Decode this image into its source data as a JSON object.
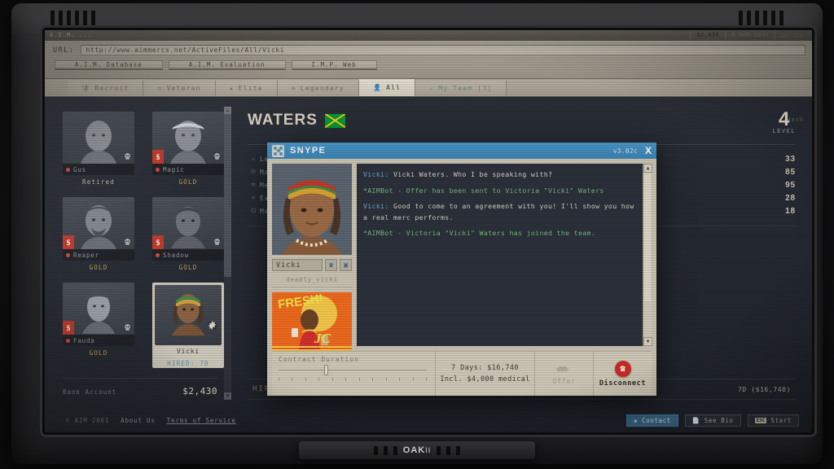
{
  "device": {
    "brand": "OAK",
    "brand_suffix": "II"
  },
  "browser": {
    "window_title": "A.I.M. ...",
    "url_label": "URL:",
    "url_value": "http://www.aimmercs.net/ActiveFiles/All/Vicki",
    "tabs": [
      {
        "label": "A.I.M. Database"
      },
      {
        "label": "A.I.M. Evaluation"
      },
      {
        "label": "I.M.P. Web"
      }
    ],
    "meta": {
      "cash": "$2,430",
      "date": "3 APR 2001",
      "signal_icon": "signal-icon",
      "battery_icon": "battery-icon"
    }
  },
  "category_tabs": [
    {
      "label": "Recruit",
      "icon": "shield-icon",
      "active": false
    },
    {
      "label": "Veteran",
      "icon": "chevrons-icon",
      "active": false
    },
    {
      "label": "Elite",
      "icon": "star-icon",
      "active": false
    },
    {
      "label": "Legendary",
      "icon": "wings-icon",
      "active": false
    },
    {
      "label": "All",
      "icon": "people-icon",
      "active": true
    },
    {
      "label": "My Team [3]",
      "icon": "check-icon",
      "active": false
    }
  ],
  "hash_text": "Hash",
  "mercs": [
    {
      "name": "Gus",
      "status": "Retired",
      "status_kind": "retired",
      "badge_s": false,
      "selected": false
    },
    {
      "name": "Magic",
      "status": "GOLD",
      "status_kind": "gold",
      "badge_s": true,
      "selected": false
    },
    {
      "name": "Reaper",
      "status": "GOLD",
      "status_kind": "gold",
      "badge_s": true,
      "selected": false
    },
    {
      "name": "Shadow",
      "status": "GOLD",
      "status_kind": "gold",
      "badge_s": true,
      "selected": false
    },
    {
      "name": "Fauda",
      "status": "GOLD",
      "status_kind": "gold",
      "badge_s": true,
      "selected": false
    },
    {
      "name": "Vicki",
      "status": "HIRED: 7D",
      "status_kind": "hired",
      "badge_s": false,
      "selected": true
    }
  ],
  "bank": {
    "label": "Bank Account",
    "value": "$2,430"
  },
  "detail": {
    "last_name": "WATERS",
    "flag": "jamaica-flag",
    "level_value": "4",
    "level_label": "LEVEL",
    "skills": [
      {
        "icon": "leadership-icon",
        "name": "Leadership",
        "value": "33"
      },
      {
        "icon": "marksmanship-icon",
        "name": "Marksmanship",
        "value": "85"
      },
      {
        "icon": "mechanical-icon",
        "name": "Mechanical",
        "value": "95"
      },
      {
        "icon": "explosives-icon",
        "name": "Explosives",
        "value": "28"
      },
      {
        "icon": "medical-icon",
        "name": "Medical",
        "value": "18"
      }
    ],
    "hired_label": "HIRED",
    "hired_value": "7D ($16,740)"
  },
  "footer": {
    "copyright": "© AIM 2001",
    "about": "About Us",
    "terms": "Terms of Service",
    "buttons": [
      {
        "label": "Contact",
        "icon": "contact-icon",
        "accent": true
      },
      {
        "label": "See Bio",
        "icon": "bio-icon",
        "accent": false
      },
      {
        "label": "Start",
        "icon": "esc-key",
        "key": "ESC",
        "accent": false
      }
    ]
  },
  "snype": {
    "app_name": "SNYPE",
    "logo_icon": "snype-dots-icon",
    "version": "v3.02c",
    "close_label": "X",
    "contact": {
      "display_name": "Vicki",
      "handle": "deadly_vicki",
      "call_icon": "phone-icon",
      "video_icon": "video-icon",
      "portrait": "vicki-portrait",
      "ad": {
        "headline": "FRESH!",
        "sub": "Run JOCola",
        "alt": "fresh-cola-ad"
      }
    },
    "messages": [
      {
        "type": "user",
        "who": "Vicki:",
        "text": "Vicki Waters. Who I be speaking with?"
      },
      {
        "type": "bot",
        "text": "*AIMBot - Offer has been sent to Victoria \"Vicki\" Waters"
      },
      {
        "type": "user",
        "who": "Vicki:",
        "text": "Good to come to an agreement with you! I'll show you how a real merc performs."
      },
      {
        "type": "bot",
        "text": "*AIMBot - Victoria \"Vicki\" Waters has joined the team."
      }
    ],
    "contract": {
      "label": "Contract Duration",
      "ticks": 12,
      "price_line1": "7 Days: $16,740",
      "price_line2": "Incl. $4,000 medical"
    },
    "actions": [
      {
        "label": "Offer",
        "icon": "handshake-icon",
        "enabled": false
      },
      {
        "label": "Disconnect",
        "icon": "hangup-icon",
        "enabled": true
      }
    ]
  }
}
